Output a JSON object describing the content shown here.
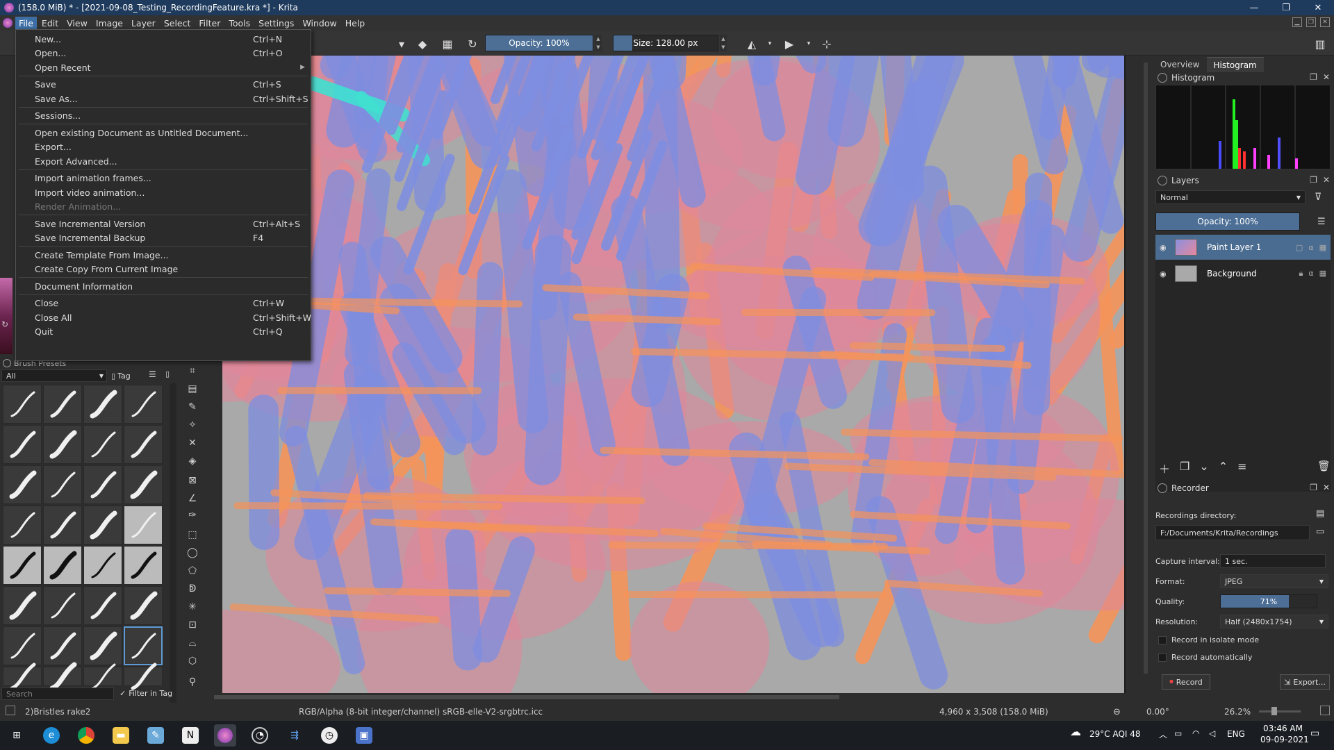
{
  "window": {
    "title": "(158.0 MiB)  * - [2021-09-08_Testing_RecordingFeature.kra *] - Krita",
    "min": "—",
    "max": "❐",
    "close": "✕"
  },
  "menubar": [
    "File",
    "Edit",
    "View",
    "Image",
    "Layer",
    "Select",
    "Filter",
    "Tools",
    "Settings",
    "Window",
    "Help"
  ],
  "toolbar": {
    "opacity_label": "Opacity: 100%",
    "opacity_value": 100,
    "size_label": "Size: 128.00 px",
    "size_fill_pct": 18
  },
  "file_menu": [
    {
      "label": "New...",
      "shortcut": "Ctrl+N"
    },
    {
      "label": "Open...",
      "shortcut": "Ctrl+O"
    },
    {
      "label": "Open Recent",
      "shortcut": "",
      "submenu": true
    },
    {
      "sep": true
    },
    {
      "label": "Save",
      "shortcut": "Ctrl+S"
    },
    {
      "label": "Save As...",
      "shortcut": "Ctrl+Shift+S"
    },
    {
      "sep": true
    },
    {
      "label": "Sessions...",
      "shortcut": ""
    },
    {
      "sep": true
    },
    {
      "label": "Open existing Document as Untitled Document...",
      "shortcut": ""
    },
    {
      "label": "Export...",
      "shortcut": ""
    },
    {
      "label": "Export Advanced...",
      "shortcut": ""
    },
    {
      "sep": true
    },
    {
      "label": "Import animation frames...",
      "shortcut": ""
    },
    {
      "label": "Import video animation...",
      "shortcut": ""
    },
    {
      "label": "Render Animation...",
      "shortcut": "",
      "disabled": true
    },
    {
      "sep": true
    },
    {
      "label": "Save Incremental Version",
      "shortcut": "Ctrl+Alt+S"
    },
    {
      "label": "Save Incremental Backup",
      "shortcut": "F4"
    },
    {
      "sep": true
    },
    {
      "label": "Create Template From Image...",
      "shortcut": ""
    },
    {
      "label": "Create Copy From Current Image",
      "shortcut": ""
    },
    {
      "sep": true
    },
    {
      "label": "Document Information",
      "shortcut": ""
    },
    {
      "sep": true
    },
    {
      "label": "Close",
      "shortcut": "Ctrl+W"
    },
    {
      "label": "Close All",
      "shortcut": "Ctrl+Shift+W"
    },
    {
      "label": "Quit",
      "shortcut": "Ctrl+Q"
    }
  ],
  "brush_presets": {
    "title": "Brush Presets",
    "filter_value": "All",
    "tag_label": "Tag",
    "search_placeholder": "Search",
    "filter_in_tag": "Filter in Tag",
    "current_brush": "2)Bristles rake2"
  },
  "right_dock": {
    "tabs": [
      "Overview",
      "Histogram"
    ],
    "histogram_title": "Histogram",
    "layers_title": "Layers",
    "blend_mode": "Normal",
    "layer_opacity": "Opacity:  100%",
    "layers": [
      {
        "name": "Paint Layer 1",
        "active": true
      },
      {
        "name": "Background",
        "active": false
      }
    ],
    "recorder": {
      "title": "Recorder",
      "dir_label": "Recordings directory:",
      "dir_value": "F:/Documents/Krita/Recordings",
      "interval_label": "Capture interval:",
      "interval_value": "1 sec.",
      "format_label": "Format:",
      "format_value": "JPEG",
      "quality_label": "Quality:",
      "quality_value": "71%",
      "quality_pct": 71,
      "resolution_label": "Resolution:",
      "resolution_value": "Half (2480x1754)",
      "isolate_label": "Record in isolate mode",
      "auto_label": "Record automatically",
      "record_btn": "Record",
      "export_btn": "Export..."
    }
  },
  "statusbar": {
    "color_info": "RGB/Alpha (8-bit integer/channel)  sRGB-elle-V2-srgbtrc.icc",
    "dimensions": "4,960 x 3,508 (158.0 MiB)",
    "rotation": "0.00°",
    "zoom": "26.2%"
  },
  "taskbar": {
    "weather": "29°C  AQI 48",
    "lang": "ENG",
    "time": "03:46 AM",
    "date": "09-09-2021"
  },
  "colors": {
    "accent": "#4b6c91",
    "titlebar": "#1e3a5c",
    "stroke_orange": "#f5935a",
    "stroke_blue": "#7e8ee0",
    "stroke_pink": "#e0869a",
    "stroke_cyan": "#3fe0d0"
  }
}
